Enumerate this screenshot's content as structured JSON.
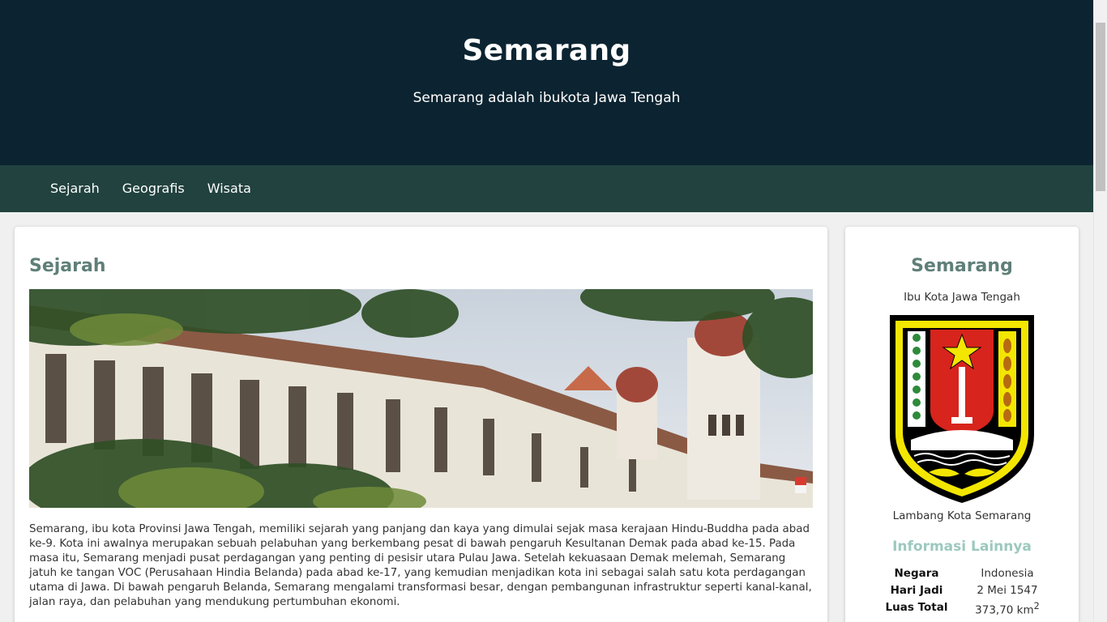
{
  "header": {
    "title": "Semarang",
    "tagline": "Semarang adalah ibukota Jawa Tengah"
  },
  "nav": {
    "items": [
      {
        "label": "Sejarah"
      },
      {
        "label": "Geografis"
      },
      {
        "label": "Wisata"
      }
    ]
  },
  "main": {
    "heading": "Sejarah",
    "photo_alt": "Lawang Sewu",
    "paragraph": "Semarang, ibu kota Provinsi Jawa Tengah, memiliki sejarah yang panjang dan kaya yang dimulai sejak masa kerajaan Hindu-Buddha pada abad ke-9. Kota ini awalnya merupakan sebuah pelabuhan yang berkembang pesat di bawah pengaruh Kesultanan Demak pada abad ke-15. Pada masa itu, Semarang menjadi pusat perdagangan yang penting di pesisir utara Pulau Jawa. Setelah kekuasaan Demak melemah, Semarang jatuh ke tangan VOC (Perusahaan Hindia Belanda) pada abad ke-17, yang kemudian menjadikan kota ini sebagai salah satu kota perdagangan utama di Jawa. Di bawah pengaruh Belanda, Semarang mengalami transformasi besar, dengan pembangunan infrastruktur seperti kanal-kanal, jalan raya, dan pelabuhan yang mendukung pertumbuhan ekonomi."
  },
  "aside": {
    "title": "Semarang",
    "subtitle": "Ibu Kota Jawa Tengah",
    "emblem_caption": "Lambang Kota Semarang",
    "info_heading": "Informasi Lainnya",
    "info": [
      {
        "key": "Negara",
        "value": "Indonesia"
      },
      {
        "key": "Hari Jadi",
        "value": "2 Mei 1547"
      },
      {
        "key": "Luas Total",
        "value": "373,70 km",
        "sup": "2"
      }
    ]
  },
  "colors": {
    "header_bg": "#0c2431",
    "nav_bg": "#21423f",
    "heading": "#5f7f79",
    "info_heading": "#9cc8bf"
  }
}
